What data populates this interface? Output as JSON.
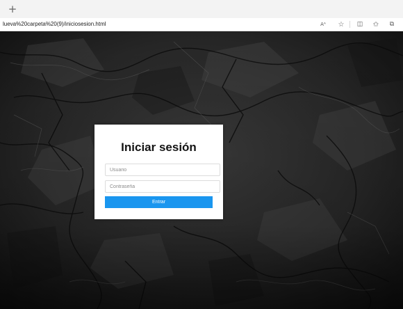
{
  "browser": {
    "new_tab_glyph": "+",
    "address": "lueva%20carpeta%20(9)/iniciosesion.html",
    "toolbar_icons": [
      "read-aloud-icon",
      "favorite-star-icon",
      "split-screen-icon",
      "favorites-icon",
      "collections-icon"
    ],
    "read_aloud_glyph": "Aᴬ",
    "star_glyph": "☆",
    "split_glyph": "◫",
    "favorites_glyph": "✩",
    "collections_glyph": "⧉"
  },
  "page": {
    "background_color": "#1e1e1e"
  },
  "login": {
    "title": "Iniciar sesión",
    "username_placeholder": "Usuario",
    "password_placeholder": "Contraseña",
    "submit_label": "Entrar",
    "accent_color": "#1a96ef"
  }
}
